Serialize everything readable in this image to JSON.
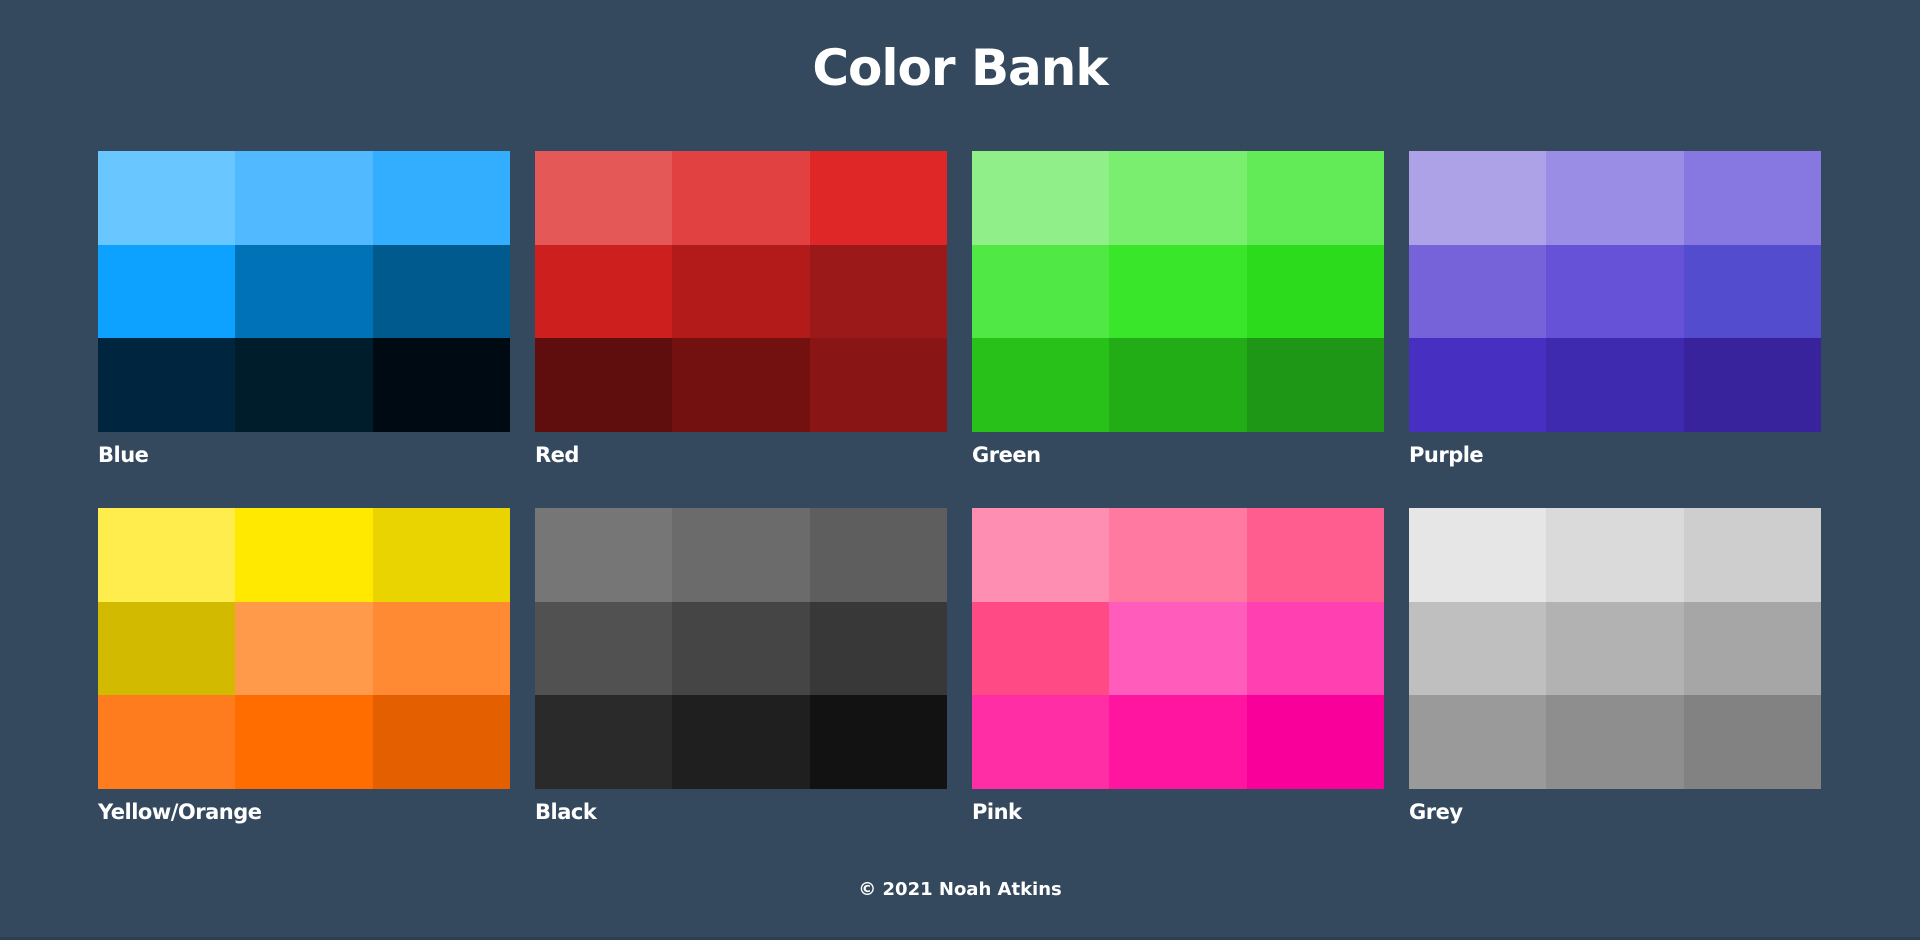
{
  "page": {
    "title": "Color Bank",
    "footer": "© 2021 Noah Atkins",
    "background": "#34495e"
  },
  "palettes": [
    {
      "name": "Blue",
      "colors": [
        "#6ac6ff",
        "#50b9ff",
        "#33aefe",
        "#0da2ff",
        "#0072b8",
        "#005a8e",
        "#00263f",
        "#001d2c",
        "#000a13"
      ]
    },
    {
      "name": "Red",
      "colors": [
        "#e45858",
        "#e14141",
        "#df2727",
        "#ce1f1f",
        "#b31b1b",
        "#9b1919",
        "#600d0d",
        "#731111",
        "#8a1515"
      ]
    },
    {
      "name": "Green",
      "colors": [
        "#90ef88",
        "#7aee6f",
        "#62eb56",
        "#4fe845",
        "#3ae62a",
        "#2cdb1c",
        "#27c11a",
        "#22ad17",
        "#1f9716"
      ]
    },
    {
      "name": "Purple",
      "colors": [
        "#ada2e8",
        "#9a8de6",
        "#8777e0",
        "#7663da",
        "#6552d6",
        "#544ccf",
        "#472fc1",
        "#3e2aaf",
        "#38239c"
      ]
    },
    {
      "name": "Yellow/Orange",
      "colors": [
        "#ffec4d",
        "#ffe900",
        "#e9d300",
        "#d1ba00",
        "#ff9a4a",
        "#ff8a33",
        "#ff7c1e",
        "#ff6d00",
        "#e45f00"
      ]
    },
    {
      "name": "Black",
      "colors": [
        "#767676",
        "#6b6b6b",
        "#5e5e5e",
        "#515151",
        "#454545",
        "#383838",
        "#2a2a2a",
        "#1f1f1f",
        "#121212"
      ]
    },
    {
      "name": "Pink",
      "colors": [
        "#ff8fb2",
        "#ff79a1",
        "#ff5c8f",
        "#ff4a86",
        "#ff5cbb",
        "#ff40b0",
        "#ff2ea5",
        "#ff15a0",
        "#f9009a"
      ]
    },
    {
      "name": "Grey",
      "colors": [
        "#e6e6e6",
        "#dadada",
        "#cecece",
        "#bfbfbf",
        "#b2b2b2",
        "#a6a6a6",
        "#9a9a9a",
        "#8e8e8e",
        "#828282"
      ]
    }
  ]
}
